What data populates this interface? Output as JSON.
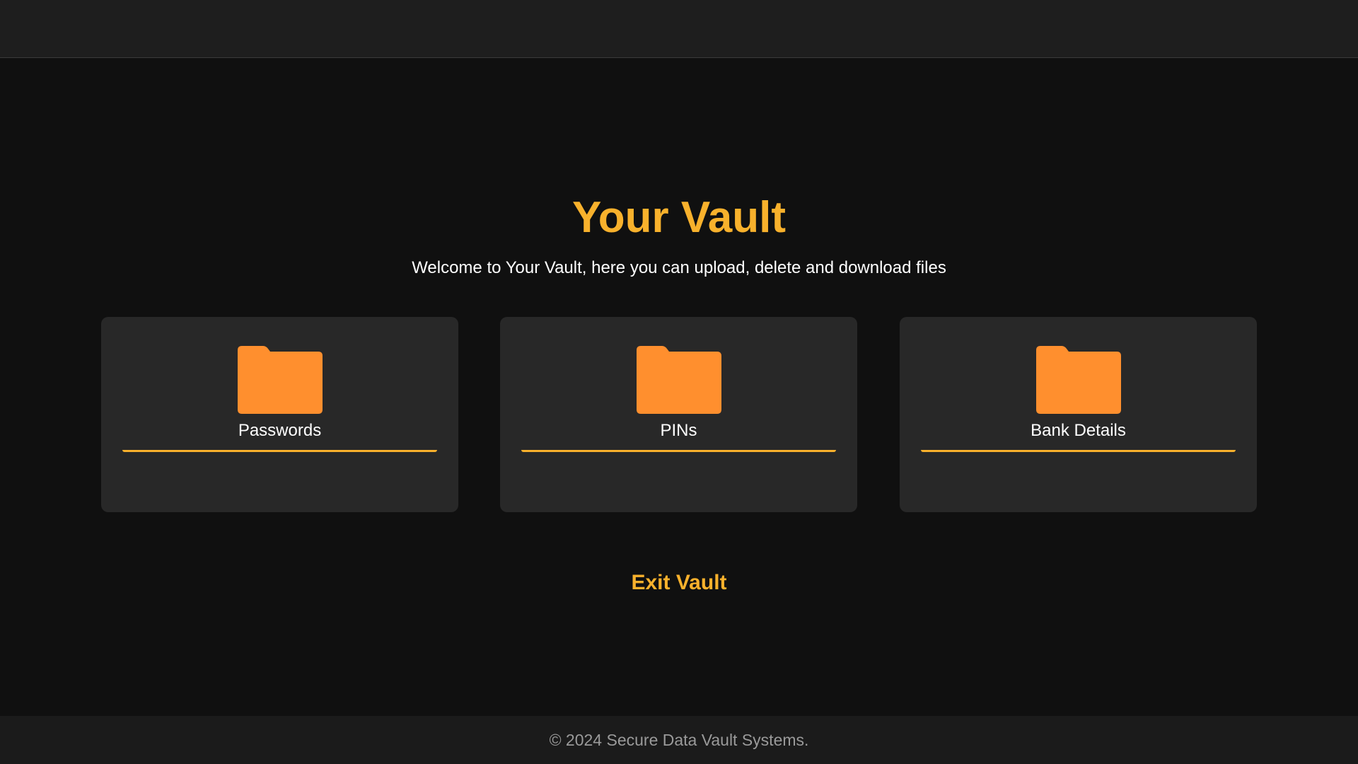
{
  "page": {
    "title": "Your Vault",
    "subtitle": "Welcome to Your Vault, here you can upload, delete and download files"
  },
  "folders": [
    {
      "label": "Passwords",
      "icon": "folder-icon"
    },
    {
      "label": "PINs",
      "icon": "folder-icon"
    },
    {
      "label": "Bank Details",
      "icon": "folder-icon"
    }
  ],
  "exit": {
    "label": "Exit Vault"
  },
  "footer": {
    "text": "© 2024 Secure Data Vault Systems."
  },
  "colors": {
    "accent": "#f8b12c",
    "folder": "#ff8f2e",
    "background": "#101010",
    "card": "#282828",
    "header": "#1e1e1e",
    "footer": "#1b1b1b"
  }
}
